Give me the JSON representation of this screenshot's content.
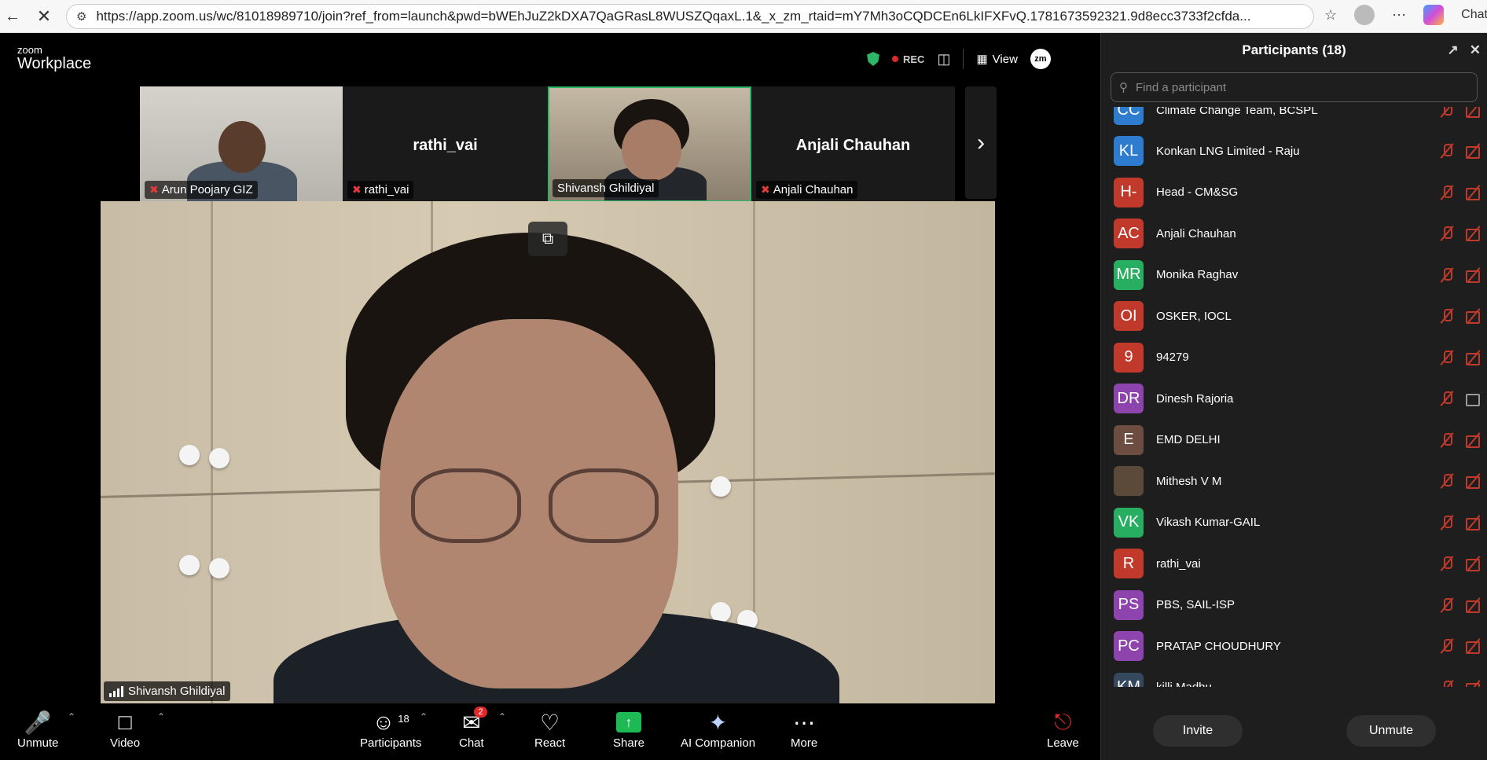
{
  "browser": {
    "url": "https://app.zoom.us/wc/81018989710/join?ref_from=launch&pwd=bWEhJuZ2kDXA7QaGRasL8WUSZQqaxL.1&_x_zm_rtaid=mY7Mh3oCQDCEn6LkIFXFvQ.1781673592321.9d8ecc3733f2cfda...",
    "chat_label": "Chat"
  },
  "app": {
    "logo_small": "zoom",
    "logo_big": "Workplace",
    "rec_label": "REC",
    "view_label": "View",
    "zm_badge": "zm"
  },
  "thumbnails": [
    {
      "tag": "Arun Poojary GIZ",
      "big_name": ""
    },
    {
      "tag": "rathi_vai",
      "big_name": "rathi_vai"
    },
    {
      "tag": "Shivansh Ghildiyal",
      "big_name": ""
    },
    {
      "tag": "Anjali Chauhan",
      "big_name": "Anjali Chauhan"
    }
  ],
  "main_video": {
    "speaker": "Shivansh Ghildiyal"
  },
  "toolbar": {
    "unmute": "Unmute",
    "video": "Video",
    "participants": "Participants",
    "participants_count": "18",
    "chat": "Chat",
    "chat_badge": "2",
    "react": "React",
    "share": "Share",
    "ai_companion": "AI Companion",
    "more": "More",
    "leave": "Leave"
  },
  "panel": {
    "title": "Participants (18)",
    "search_placeholder": "Find a participant",
    "partial_row": {
      "initials": "CC",
      "name": "Climate Change Team, BCSPL",
      "color": "#2d7ccf"
    },
    "participants": [
      {
        "initials": "KL",
        "name": "Konkan LNG Limited - Raju",
        "color": "#2d7ccf",
        "video": false
      },
      {
        "initials": "H-",
        "name": "Head - CM&SG",
        "color": "#c0392b",
        "video": false
      },
      {
        "initials": "AC",
        "name": "Anjali Chauhan",
        "color": "#c0392b",
        "video": false
      },
      {
        "initials": "MR",
        "name": "Monika Raghav",
        "color": "#27ae60",
        "video": false
      },
      {
        "initials": "OI",
        "name": "OSKER, IOCL",
        "color": "#c0392b",
        "video": false
      },
      {
        "initials": "9",
        "name": "94279",
        "color": "#c0392b",
        "video": false
      },
      {
        "initials": "DR",
        "name": "Dinesh Rajoria",
        "color": "#8e44ad",
        "video": true
      },
      {
        "initials": "E",
        "name": "EMD DELHI",
        "color": "#6d4c41",
        "video": false
      },
      {
        "initials": "",
        "name": "Mithesh V M",
        "color": "#5b4a3a",
        "video": false
      },
      {
        "initials": "VK",
        "name": "Vikash Kumar-GAIL",
        "color": "#27ae60",
        "video": false
      },
      {
        "initials": "R",
        "name": "rathi_vai",
        "color": "#c0392b",
        "video": false
      },
      {
        "initials": "PS",
        "name": "PBS, SAIL-ISP",
        "color": "#8e44ad",
        "video": false
      },
      {
        "initials": "PC",
        "name": "PRATAP CHOUDHURY",
        "color": "#8e44ad",
        "video": false
      },
      {
        "initials": "KM",
        "name": "killi Madhu",
        "color": "#34495e",
        "video": false
      }
    ],
    "invite": "Invite",
    "unmute": "Unmute"
  }
}
